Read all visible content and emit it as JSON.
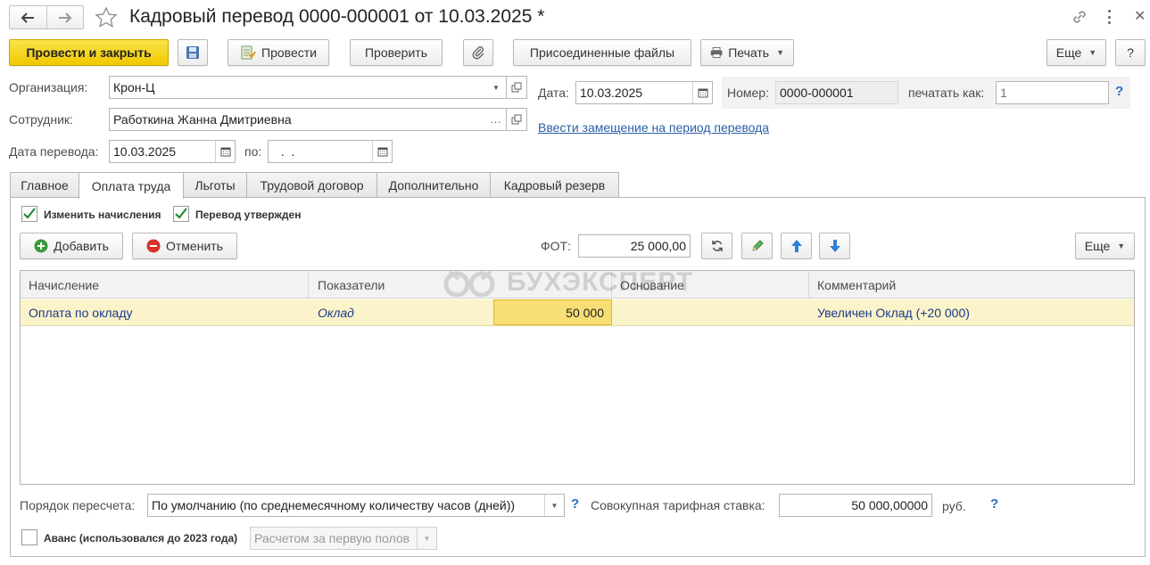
{
  "window": {
    "title": "Кадровый перевод 0000-000001 от 10.03.2025 *"
  },
  "toolbar": {
    "post_close_label": "Провести и закрыть",
    "post_label": "Провести",
    "check_label": "Проверить",
    "attached_files_label": "Присоединенные файлы",
    "print_label": "Печать",
    "more_label": "Еще",
    "help_label": "?"
  },
  "header": {
    "org_label": "Организация:",
    "org_value": "Крон-Ц",
    "employee_label": "Сотрудник:",
    "employee_value": "Работкина Жанна Дмитриевна",
    "transfer_date_label": "Дата перевода:",
    "transfer_date_value": "10.03.2025",
    "to_label": "по:",
    "to_value": " .  .",
    "date_label": "Дата:",
    "date_value": "10.03.2025",
    "number_label": "Номер:",
    "number_value": "0000-000001",
    "print_as_label": "печатать как:",
    "print_as_placeholder": "1",
    "replacement_link": "Ввести замещение на период перевода"
  },
  "tabs": [
    {
      "label": "Главное"
    },
    {
      "label": "Оплата труда"
    },
    {
      "label": "Льготы"
    },
    {
      "label": "Трудовой договор"
    },
    {
      "label": "Дополнительно"
    },
    {
      "label": "Кадровый резерв"
    }
  ],
  "pay_tab": {
    "change_accruals_label": "Изменить начисления",
    "transfer_approved_label": "Перевод утвержден",
    "add_label": "Добавить",
    "cancel_label": "Отменить",
    "fot_label": "ФОТ:",
    "fot_value": "25 000,00",
    "more_label": "Еще",
    "columns": [
      "Начисление",
      "Показатели",
      "Основание",
      "Комментарий"
    ],
    "rows": [
      {
        "accrual": "Оплата по окладу",
        "indicator": "Оклад",
        "amount": "50 000",
        "basis": "",
        "comment": "Увеличен Оклад (+20 000)"
      }
    ],
    "watermark": "БУХЭКСПЕРТ",
    "recalc_label": "Порядок пересчета:",
    "recalc_value": "По умолчанию (по среднемесячному количеству часов (дней))",
    "rate_label": "Совокупная тарифная ставка:",
    "rate_value": "50 000,00000",
    "currency": "руб.",
    "advance_label": "Аванс (использовался до 2023 года)",
    "advance_value": "Расчетом за первую полов"
  },
  "colors": {
    "primary": "#f5d20f",
    "selected_row": "#fbf3c9",
    "active_cell": "#f7df75",
    "link": "#2a5fa8",
    "check": "#1f8a3c"
  }
}
